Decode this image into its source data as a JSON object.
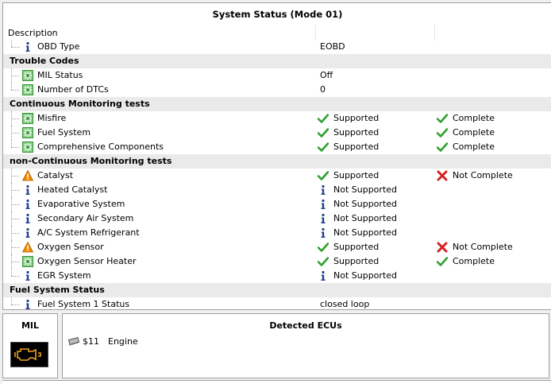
{
  "title": "System Status (Mode 01)",
  "description_header": "Description",
  "obd_type": {
    "label": "OBD Type",
    "value": "EOBD",
    "icon": "info-icon"
  },
  "sections": [
    {
      "title": "Trouble Codes",
      "rows": [
        {
          "icon": "monitor-icon",
          "label": "MIL Status",
          "value": "Off"
        },
        {
          "icon": "monitor-icon",
          "label": "Number of DTCs",
          "value": "0"
        }
      ]
    },
    {
      "title": "Continuous Monitoring tests",
      "rows": [
        {
          "icon": "monitor-icon",
          "label": "Misfire",
          "support": "Supported",
          "support_icon": "check-icon",
          "status": "Complete",
          "status_icon": "check-icon"
        },
        {
          "icon": "monitor-icon",
          "label": "Fuel System",
          "support": "Supported",
          "support_icon": "check-icon",
          "status": "Complete",
          "status_icon": "check-icon"
        },
        {
          "icon": "monitor-icon",
          "label": "Comprehensive Components",
          "support": "Supported",
          "support_icon": "check-icon",
          "status": "Complete",
          "status_icon": "check-icon"
        }
      ]
    },
    {
      "title": "non-Continuous Monitoring tests",
      "rows": [
        {
          "icon": "warning-icon",
          "label": "Catalyst",
          "support": "Supported",
          "support_icon": "check-icon",
          "status": "Not Complete",
          "status_icon": "cross-icon"
        },
        {
          "icon": "info-icon",
          "label": "Heated Catalyst",
          "support": "Not Supported",
          "support_icon": "info-icon"
        },
        {
          "icon": "info-icon",
          "label": "Evaporative System",
          "support": "Not Supported",
          "support_icon": "info-icon"
        },
        {
          "icon": "info-icon",
          "label": "Secondary Air System",
          "support": "Not Supported",
          "support_icon": "info-icon"
        },
        {
          "icon": "info-icon",
          "label": "A/C System Refrigerant",
          "support": "Not Supported",
          "support_icon": "info-icon"
        },
        {
          "icon": "warning-icon",
          "label": "Oxygen Sensor",
          "support": "Supported",
          "support_icon": "check-icon",
          "status": "Not Complete",
          "status_icon": "cross-icon"
        },
        {
          "icon": "monitor-icon",
          "label": "Oxygen Sensor Heater",
          "support": "Supported",
          "support_icon": "check-icon",
          "status": "Complete",
          "status_icon": "check-icon"
        },
        {
          "icon": "info-icon",
          "label": "EGR System",
          "support": "Not Supported",
          "support_icon": "info-icon"
        }
      ]
    },
    {
      "title": "Fuel System Status",
      "rows": [
        {
          "icon": "info-icon",
          "label": "Fuel System 1 Status",
          "value": "closed loop"
        }
      ]
    }
  ],
  "mil": {
    "title": "MIL",
    "icon": "engine-check-icon",
    "lamp_color": "#f0a020"
  },
  "ecus": {
    "title": "Detected ECUs",
    "items": [
      {
        "icon": "ecu-chip-icon",
        "id": "$11",
        "name": "Engine"
      }
    ]
  },
  "colors": {
    "section_bg": "#eaeaea",
    "check": "#2ea02e",
    "cross": "#d42020",
    "warning": "#f08a00",
    "info": "#1f3f8f"
  }
}
